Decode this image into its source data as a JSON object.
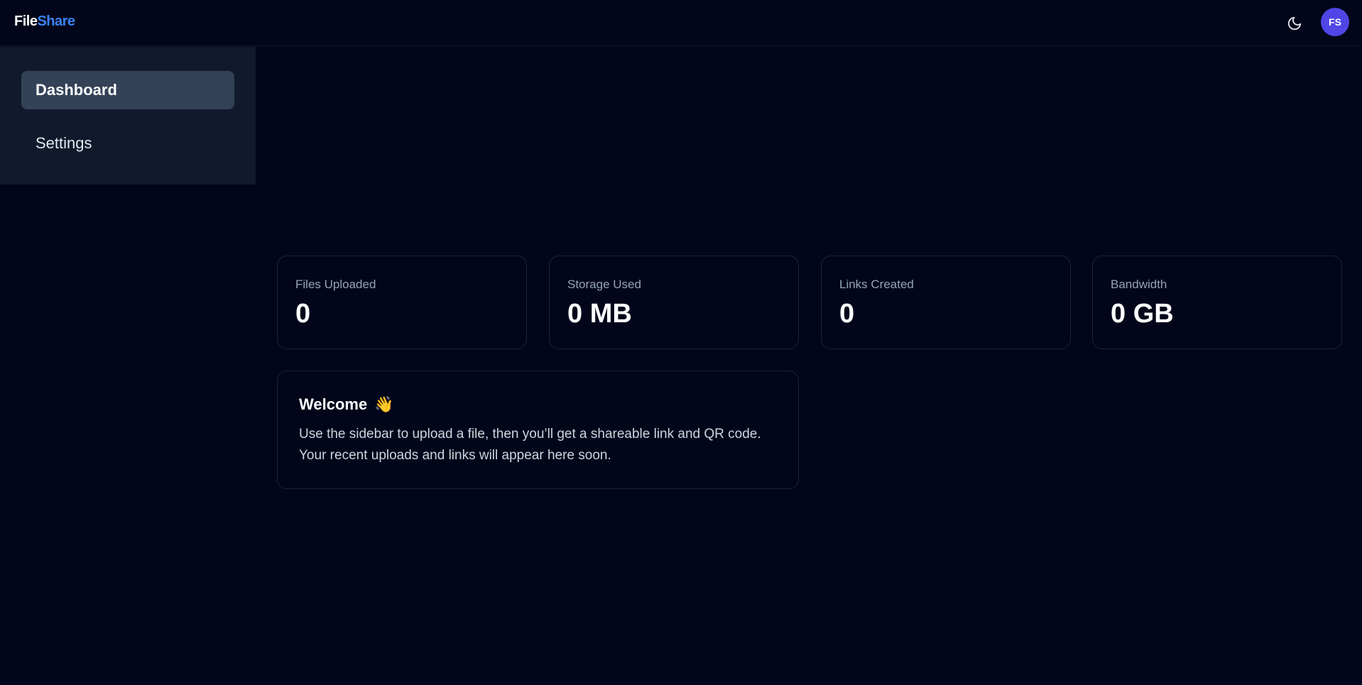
{
  "header": {
    "brand_part1": "File",
    "brand_part2": "Share",
    "theme_icon": "moon-icon",
    "avatar_initials": "FS"
  },
  "sidebar": {
    "items": [
      {
        "label": "Dashboard",
        "active": true
      },
      {
        "label": "Settings",
        "active": false
      }
    ]
  },
  "stats": [
    {
      "label": "Files Uploaded",
      "value": "0"
    },
    {
      "label": "Storage Used",
      "value": "0 MB"
    },
    {
      "label": "Links Created",
      "value": "0"
    },
    {
      "label": "Bandwidth",
      "value": "0 GB"
    }
  ],
  "welcome": {
    "title": "Welcome",
    "emoji": "👋",
    "text": "Use the sidebar to upload a file, then you’ll get a shareable link and QR code. Your recent uploads and links will appear here soon."
  },
  "colors": {
    "background": "#03061a",
    "accent": "#3b82f6",
    "avatar": "#4f46e5",
    "sidebar": "#111a2d",
    "active_nav": "#334257"
  }
}
